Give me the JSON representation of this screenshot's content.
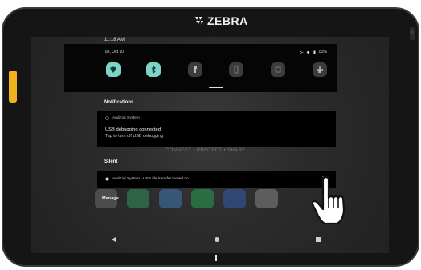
{
  "device": {
    "brand": "ZEBRA"
  },
  "status": {
    "time": "11:18 AM",
    "date": "Tue, Oct 10",
    "battery": "83%"
  },
  "quick_settings": {
    "tiles": [
      {
        "name": "wifi",
        "active": true
      },
      {
        "name": "bluetooth",
        "active": true
      },
      {
        "name": "flashlight",
        "active": false
      },
      {
        "name": "battery-saver",
        "active": false
      },
      {
        "name": "auto-rotate",
        "active": false
      },
      {
        "name": "airplane-mode",
        "active": false
      }
    ]
  },
  "notifications": {
    "section_label": "Notifications",
    "items": [
      {
        "source": "Android System",
        "title": "USB debugging connected",
        "body": "Tap to turn off USB debugging"
      }
    ]
  },
  "silent": {
    "section_label": "Silent",
    "items": [
      {
        "text": "Android System · USB file transfer turned on"
      }
    ]
  },
  "manage_label": "Manage",
  "home_tagline": "CONNECT • PROTECT • SHARE",
  "colors": {
    "accent": "#7ed3c9",
    "background": "#262626",
    "card": "#000000",
    "rail": "#f2b01e"
  }
}
